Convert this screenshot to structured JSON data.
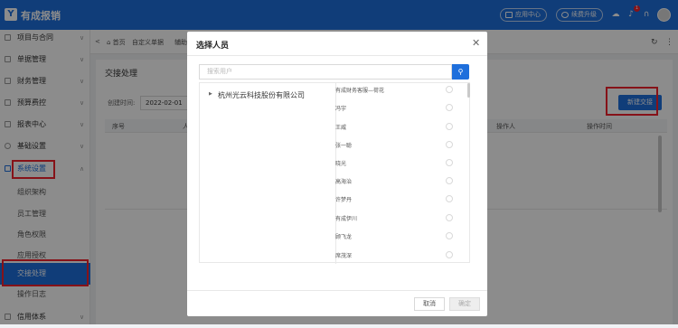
{
  "app": {
    "logo_char": "Y",
    "title": "有成报销"
  },
  "top": {
    "app_center": "应用中心",
    "renew": "续费升级",
    "badge": "1"
  },
  "sidebar": {
    "items": [
      {
        "label": "项目与合同"
      },
      {
        "label": "单据管理"
      },
      {
        "label": "财务管理"
      },
      {
        "label": "预算费控"
      },
      {
        "label": "报表中心"
      },
      {
        "label": "基础设置"
      },
      {
        "label": "系统设置"
      }
    ],
    "sub_items": [
      {
        "label": "组织架构"
      },
      {
        "label": "员工管理"
      },
      {
        "label": "角色权限"
      },
      {
        "label": "应用授权"
      },
      {
        "label": "交接处理"
      },
      {
        "label": "操作日志"
      }
    ],
    "bottom_item": {
      "label": "信用体系"
    }
  },
  "tabs": {
    "home": "首页",
    "custom": "自定义单据",
    "other": "辅助"
  },
  "content": {
    "title": "交接处理",
    "filter_label": "创建时间:",
    "filter_date": "2022-02-01",
    "new_button": "新建交接",
    "columns": [
      "序号",
      "人",
      "操作人",
      "操作时间"
    ]
  },
  "modal": {
    "title": "选择人员",
    "search_placeholder": "搜索用户",
    "tree_root": "杭州光云科技股份有限公司",
    "people": [
      "有成财务客服—荷花",
      "冯宇",
      "王威",
      "张一聪",
      "晓光",
      "高海治",
      "许梦丹",
      "有成伊川",
      "顾飞龙",
      "席茂深"
    ],
    "cancel": "取消",
    "ok": "确定"
  },
  "colors": {
    "primary": "#1e6fdc",
    "highlight": "#f5222d"
  }
}
